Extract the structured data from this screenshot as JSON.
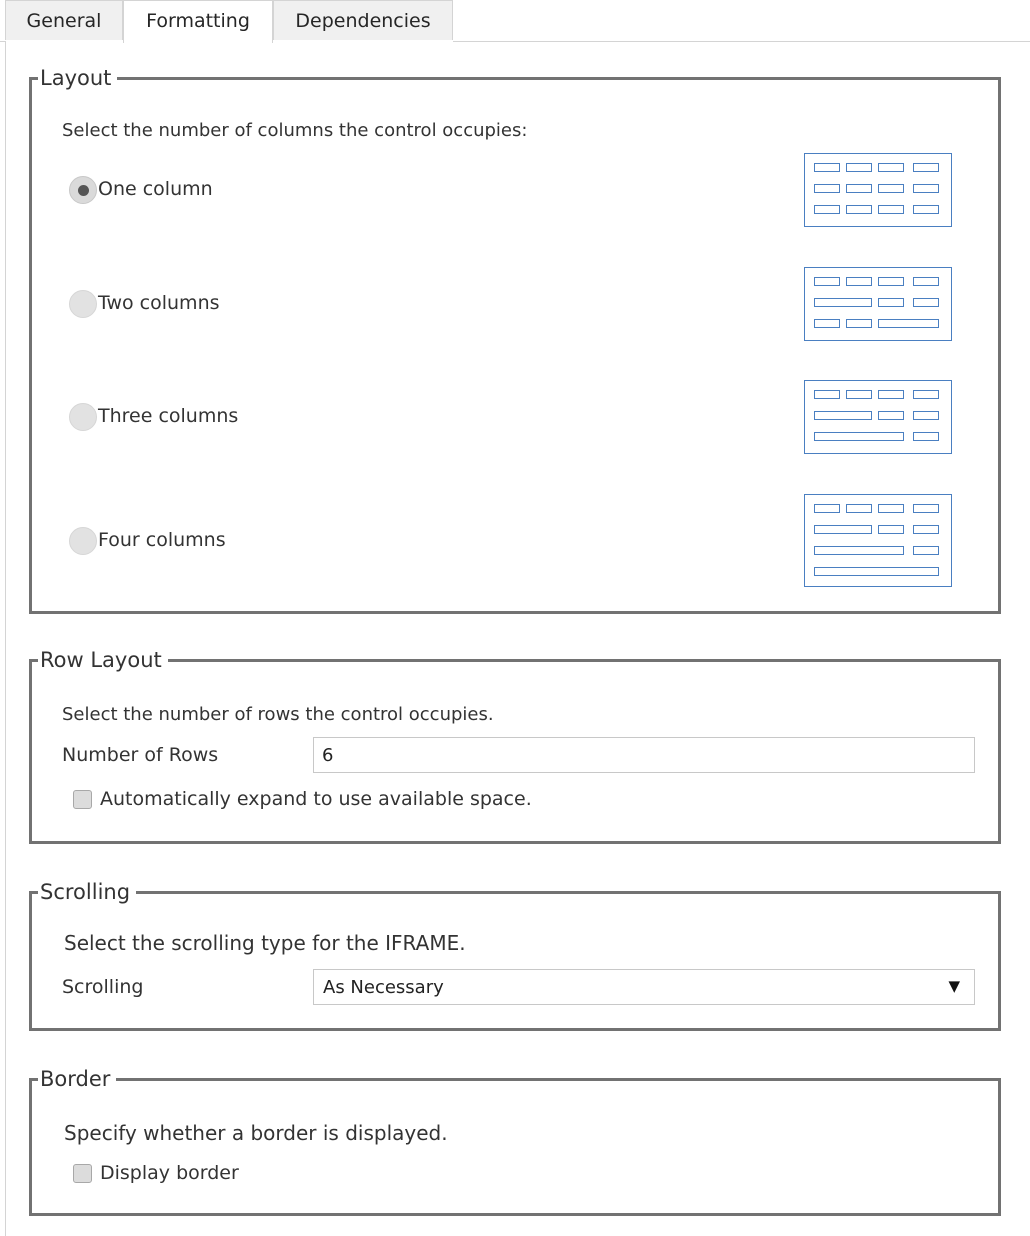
{
  "tabs": [
    {
      "label": "General"
    },
    {
      "label": "Formatting",
      "active": true
    },
    {
      "label": "Dependencies"
    }
  ],
  "layout": {
    "legend": "Layout",
    "description": "Select the number of columns the control occupies:",
    "options": [
      {
        "label": "One column",
        "checked": true
      },
      {
        "label": "Two columns",
        "checked": false
      },
      {
        "label": "Three columns",
        "checked": false
      },
      {
        "label": "Four columns",
        "checked": false
      }
    ]
  },
  "row_layout": {
    "legend": "Row Layout",
    "description": "Select the number of rows the control occupies.",
    "rows_label": "Number of Rows",
    "rows_value": "6",
    "auto_expand_label": "Automatically expand to use available space.",
    "auto_expand_checked": false
  },
  "scrolling": {
    "legend": "Scrolling",
    "description": "Select the scrolling type for the IFRAME.",
    "field_label": "Scrolling",
    "selected": "As Necessary",
    "arrow": "▼"
  },
  "border": {
    "legend": "Border",
    "description": "Specify whether a border is displayed.",
    "display_border_label": "Display border",
    "display_border_checked": false
  },
  "colors": {
    "accent_blue": "#4a7fc1",
    "group_border": "#727272"
  }
}
